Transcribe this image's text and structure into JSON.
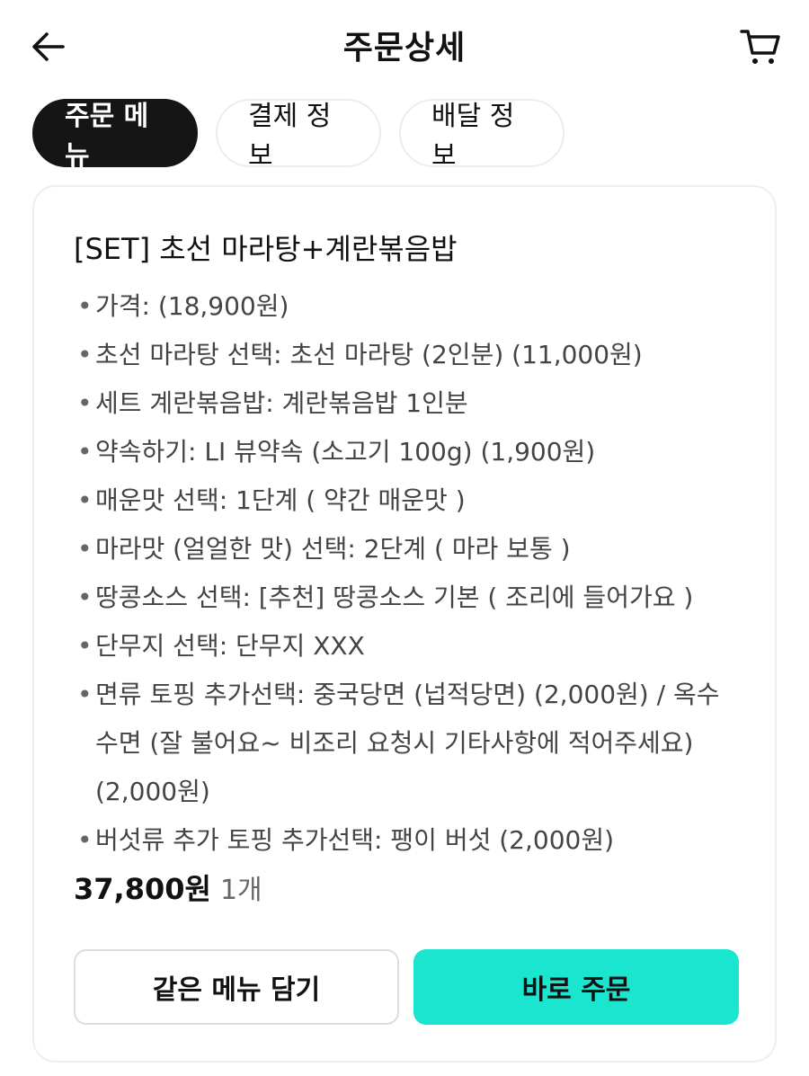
{
  "header": {
    "title": "주문상세",
    "back_icon": "arrow-left-icon",
    "cart_icon": "cart-icon"
  },
  "tabs": [
    {
      "label": "주문 메뉴",
      "active": true
    },
    {
      "label": "결제 정보",
      "active": false
    },
    {
      "label": "배달 정보",
      "active": false
    }
  ],
  "order": {
    "menu_name": "[SET] 초선 마라탕+계란볶음밥",
    "options": [
      "가격:  (18,900원)",
      "초선 마라탕 선택: 초선 마라탕 (2인분) (11,000원)",
      "세트 계란볶음밥: 계란볶음밥 1인분",
      "약속하기: LI 뷰약속 (소고기 100g) (1,900원)",
      "매운맛 선택: 1단계 ( 약간 매운맛 )",
      "마라맛 (얼얼한 맛) 선택: 2단계 ( 마라 보통 )",
      "땅콩소스 선택: [추천] 땅콩소스 기본 ( 조리에 들어가요 )",
      "단무지 선택: 단무지 XXX",
      "면류 토핑 추가선택: 중국당면 (넙적당면) (2,000원) / 옥수수면 (잘 불어요~ 비조리 요청시 기타사항에 적어주세요) (2,000원)",
      "버섯류 추가 토핑 추가선택: 팽이 버섯 (2,000원)"
    ],
    "bullet": "•",
    "price": "37,800원",
    "quantity": "1개"
  },
  "actions": {
    "same_menu_label": "같은 메뉴 담기",
    "order_now_label": "바로 주문"
  },
  "colors": {
    "accent": "#1ae6d0",
    "active_tab": "#151515"
  }
}
